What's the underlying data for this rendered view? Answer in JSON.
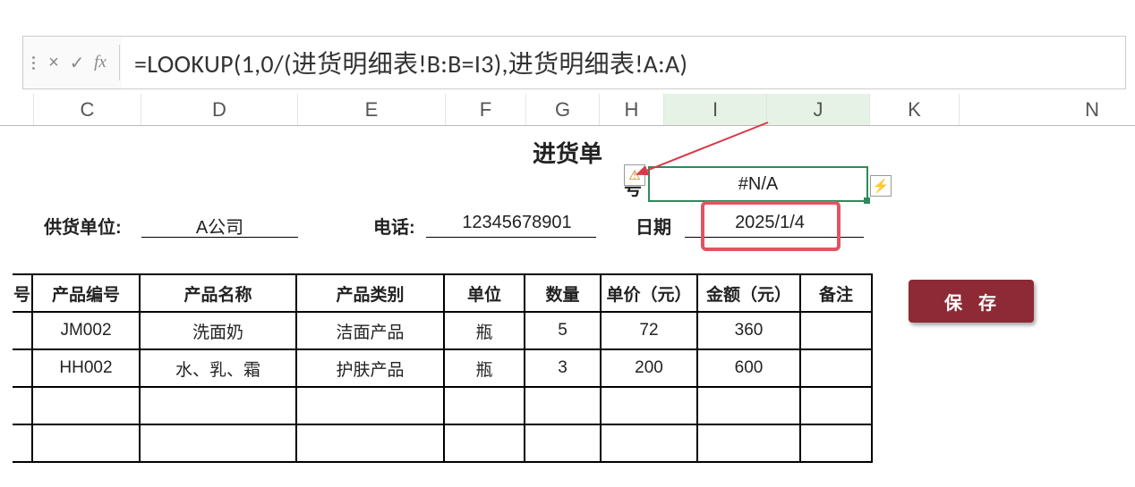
{
  "formula_bar": {
    "cancel_glyph": "×",
    "confirm_glyph": "✓",
    "fx_glyph": "fx",
    "formula": "=LOOKUP(1,0/(进货明细表!B:B=I3),进货明细表!A:A)"
  },
  "columns": {
    "C": "C",
    "D": "D",
    "E": "E",
    "F": "F",
    "G": "G",
    "H": "H",
    "I": "I",
    "J": "J",
    "K": "K",
    "N": "N"
  },
  "sheet": {
    "title": "进货单",
    "order_label": "号",
    "order_value": "#N/A",
    "supplier_label": "供货单位:",
    "supplier_value": "A公司",
    "phone_label": "电话:",
    "phone_value": "12345678901",
    "date_label": "日期",
    "date_value": "2025/1/4",
    "save_label": "保存"
  },
  "icons": {
    "warn": "⚠",
    "flash": "⚡"
  },
  "table": {
    "headers": {
      "seq": "号",
      "code": "产品编号",
      "name": "产品名称",
      "cat": "产品类别",
      "unit": "单位",
      "qty": "数量",
      "price": "单价（元）",
      "amount": "金额（元）",
      "note": "备注"
    },
    "rows": [
      {
        "code": "JM002",
        "name": "洗面奶",
        "cat": "洁面产品",
        "unit": "瓶",
        "qty": "5",
        "price": "72",
        "amount": "360",
        "note": ""
      },
      {
        "code": "HH002",
        "name": "水、乳、霜",
        "cat": "护肤产品",
        "unit": "瓶",
        "qty": "3",
        "price": "200",
        "amount": "600",
        "note": ""
      },
      {
        "code": "",
        "name": "",
        "cat": "",
        "unit": "",
        "qty": "",
        "price": "",
        "amount": "",
        "note": ""
      },
      {
        "code": "",
        "name": "",
        "cat": "",
        "unit": "",
        "qty": "",
        "price": "",
        "amount": "",
        "note": ""
      }
    ]
  }
}
